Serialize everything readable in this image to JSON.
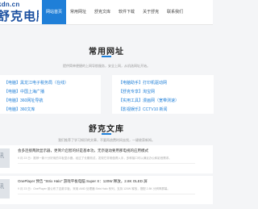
{
  "header": {
    "logo_url": "kdn.cn",
    "logo_name": "舒克电脑",
    "nav": [
      "网站首页",
      "常用网址",
      "舒克文库",
      "软件下载",
      "关于舒克",
      "联系我们"
    ]
  },
  "links_section": {
    "title": "常用网址",
    "subtitle": "提供简单便捷的上网导航服务，安全上网，从机选网址开始。",
    "left": [
      "【电脑】黑龙江电子税务局（在线）",
      "【电脑】中国上海广播",
      "【电脑】360网址导航",
      "【电脑】360文库"
    ],
    "right": [
      "【电脑助手】打印机驱动网",
      "【舒克专享】淘宝网",
      "【实用工具】漫画网（宽带测速）",
      "【影视娱乐】CCTV10 新闻"
    ]
  },
  "library_section": {
    "title": "舒克文库",
    "subtitle": "我们推荐了学习知识的文章，不要再浪费时间去找，一键收获新知。"
  },
  "articles": [
    {
      "title": "会多连接两款显示器，更简介启智的好是基本功，无奈驱动要用那电视的应用模式",
      "meta": "9 月 23 日：推荐一款十分好用的平板显示器，经过了长期测试，发现它非常值得入手，多种接口可以满足办公和影音需求。"
    },
    {
      "title": "OnePlayer 预告 \"Strix Halo\" 游戏平板电脑 Super X：120W 释放，2.8K OLED 屏",
      "meta": "9 月 23 日：OnePlayer 曾公布了这款平板，采用 AMD 处理器 Strix Halo 系列，支持 120W 释放，搭配 2.8K 分辨率屏幕。"
    }
  ],
  "colors": {
    "accent": "#1f7fd8",
    "logo": "#1a4fa0",
    "background": "#f4f5f7"
  },
  "icons": {
    "thumb": "placeholder-thumb-icon",
    "thumb_text": "讯"
  }
}
